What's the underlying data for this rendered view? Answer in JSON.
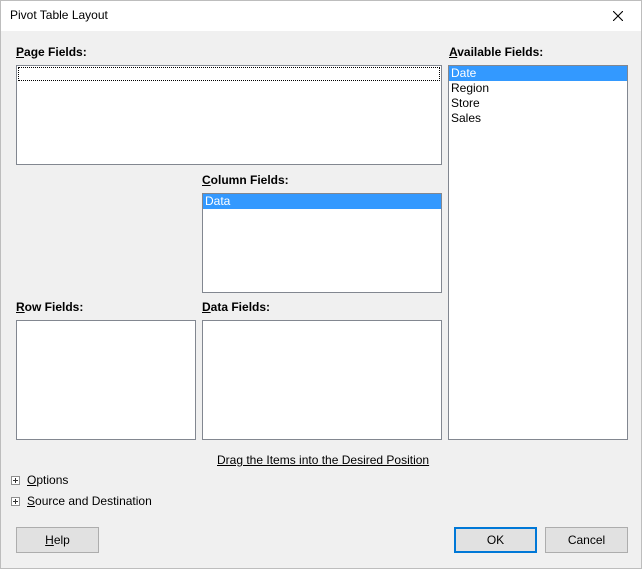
{
  "window": {
    "title": "Pivot Table Layout",
    "close_icon": "close-icon"
  },
  "labels": {
    "page_fields_acc": "P",
    "page_fields_rest": "age Fields:",
    "available_fields_acc": "A",
    "available_fields_rest": "vailable Fields:",
    "column_fields_acc": "C",
    "column_fields_rest": "olumn Fields:",
    "row_fields_acc": "R",
    "row_fields_rest": "ow Fields:",
    "data_fields_acc": "D",
    "data_fields_rest": "ata Fields:"
  },
  "available_fields": [
    "Date",
    "Region",
    "Store",
    "Sales"
  ],
  "available_selected_index": 0,
  "column_fields": [
    "Data"
  ],
  "hint": "Drag the Items into the Desired Position",
  "expanders": {
    "options_acc": "O",
    "options_rest": "ptions",
    "source_acc": "S",
    "source_rest": "ource and Destination"
  },
  "buttons": {
    "help_acc": "H",
    "help_rest": "elp",
    "ok": "OK",
    "cancel": "Cancel"
  },
  "colors": {
    "selection": "#3399ff",
    "default_button_border": "#0078d7"
  }
}
